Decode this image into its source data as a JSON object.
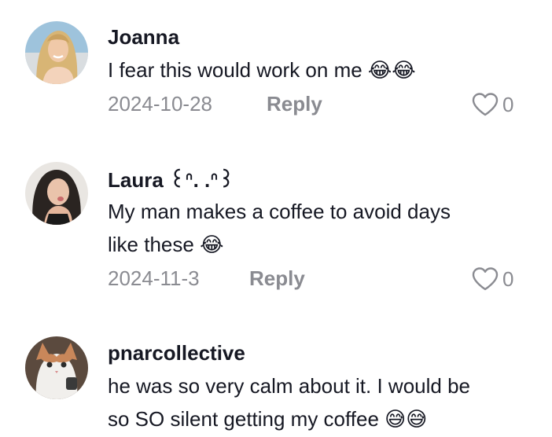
{
  "comments": [
    {
      "username": "Joanna",
      "lines": [
        "I fear this would work on me 😂😂"
      ],
      "date": "2024-10-28",
      "reply_label": "Reply",
      "like_count": "0",
      "avatar_icon": "user-photo-blonde-woman"
    },
    {
      "username": "Laura ꒰ᐢ. .ᐢ꒱",
      "lines": [
        "My man makes a coffee to avoid days",
        "like these 😂"
      ],
      "date": "2024-11-3",
      "reply_label": "Reply",
      "like_count": "0",
      "avatar_icon": "user-photo-dark-hair-woman"
    },
    {
      "username": "pnarcollective",
      "lines": [
        "he was so very calm about it. I would be",
        "so SO silent getting my coffee 😅😅"
      ],
      "avatar_icon": "user-photo-cat"
    }
  ],
  "colors": {
    "primary_text": "#161823",
    "secondary_text": "#8a8b91",
    "background": "#ffffff"
  },
  "icons": {
    "like": "heart-outline-icon"
  }
}
